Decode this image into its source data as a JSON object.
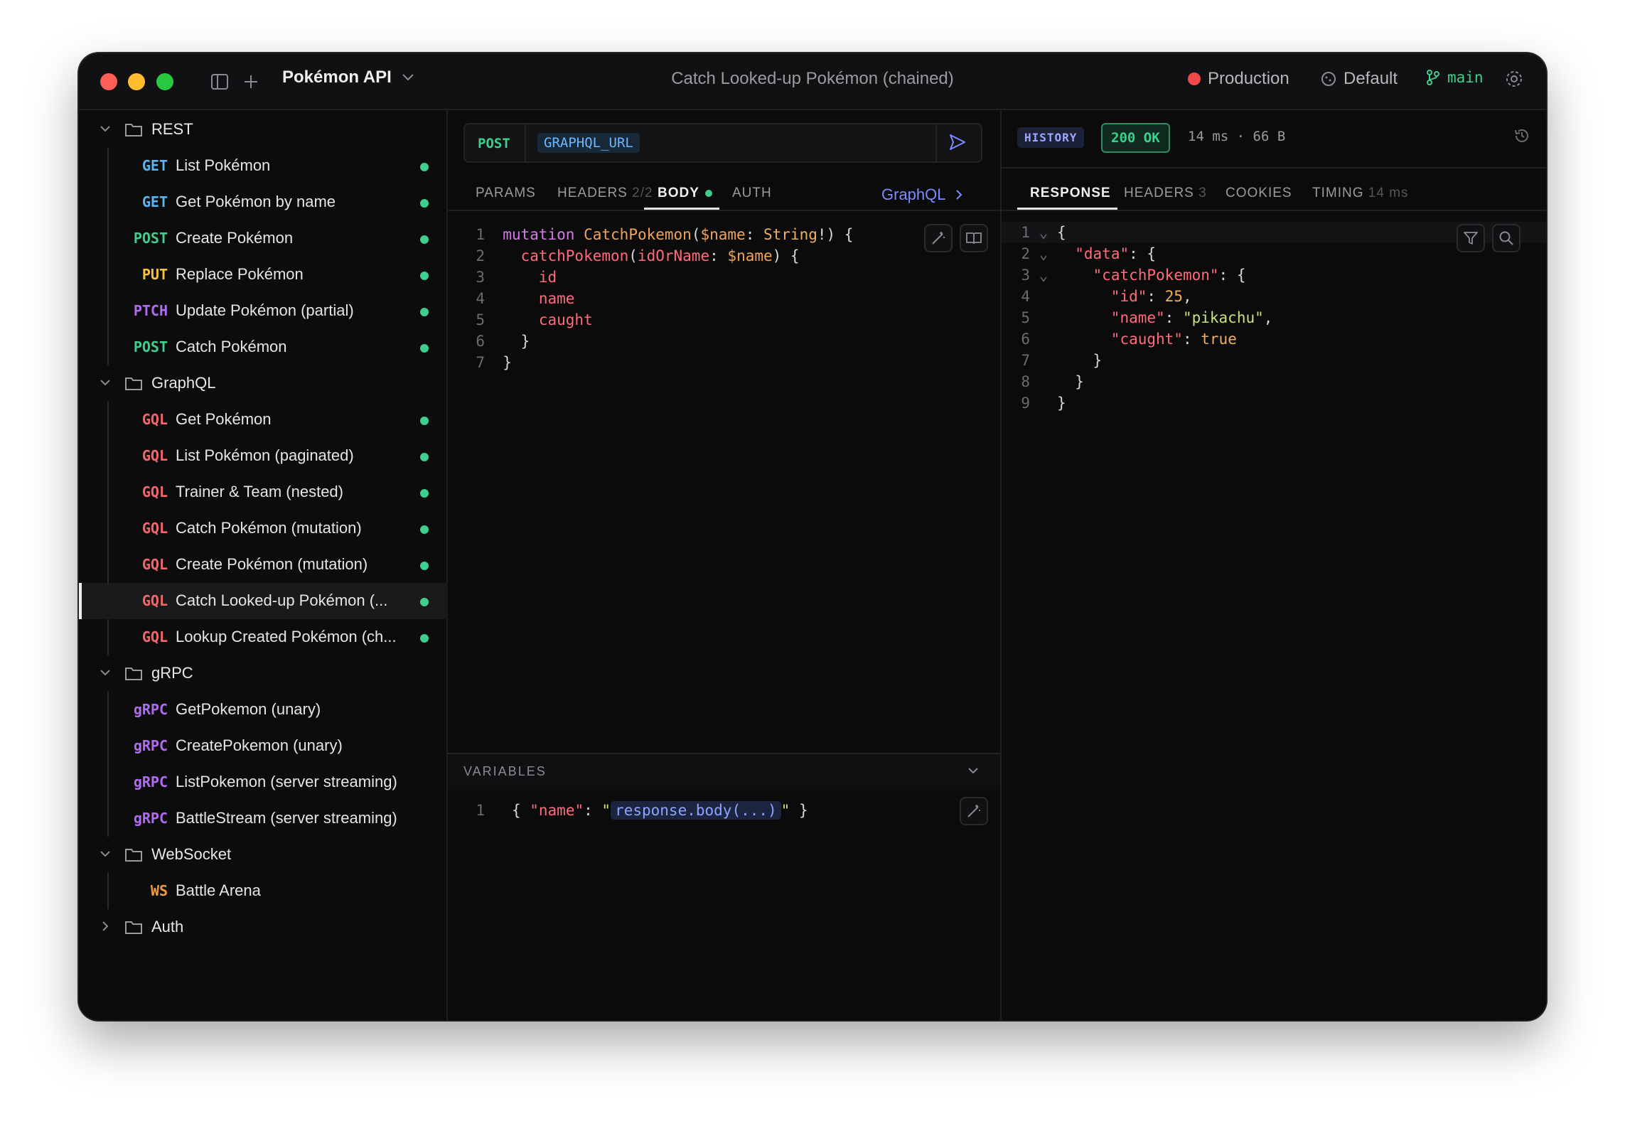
{
  "titlebar": {
    "app_name": "Pokémon API",
    "request_title": "Catch Looked-up Pokémon (chained)",
    "env_production": "Production",
    "env_default": "Default",
    "branch": "main"
  },
  "sidebar": {
    "folders": [
      {
        "name": "REST",
        "expanded": true
      },
      {
        "name": "GraphQL",
        "expanded": true
      },
      {
        "name": "gRPC",
        "expanded": true
      },
      {
        "name": "WebSocket",
        "expanded": true
      },
      {
        "name": "Auth",
        "expanded": false
      }
    ],
    "rest": [
      {
        "method": "GET",
        "label": "List Pokémon",
        "color": "#5ab4f0"
      },
      {
        "method": "GET",
        "label": "Get Pokémon by name",
        "color": "#5ab4f0"
      },
      {
        "method": "POST",
        "label": "Create Pokémon",
        "color": "#3ecf8e"
      },
      {
        "method": "PUT",
        "label": "Replace Pokémon",
        "color": "#f5c242"
      },
      {
        "method": "PTCH",
        "label": "Update Pokémon (partial)",
        "color": "#b06cf0"
      },
      {
        "method": "POST",
        "label": "Catch Pokémon",
        "color": "#3ecf8e"
      }
    ],
    "graphql": [
      {
        "method": "GQL",
        "label": "Get Pokémon",
        "color": "#f0686b"
      },
      {
        "method": "GQL",
        "label": "List Pokémon (paginated)",
        "color": "#f0686b"
      },
      {
        "method": "GQL",
        "label": "Trainer & Team (nested)",
        "color": "#f0686b"
      },
      {
        "method": "GQL",
        "label": "Catch Pokémon (mutation)",
        "color": "#f0686b"
      },
      {
        "method": "GQL",
        "label": "Create Pokémon (mutation)",
        "color": "#f0686b"
      },
      {
        "method": "GQL",
        "label": "Catch Looked-up Pokémon (...",
        "color": "#f0686b",
        "selected": true
      },
      {
        "method": "GQL",
        "label": "Lookup Created Pokémon (ch...",
        "color": "#f0686b"
      }
    ],
    "grpc": [
      {
        "method": "gRPC",
        "label": "GetPokemon (unary)",
        "color": "#b06cf0"
      },
      {
        "method": "gRPC",
        "label": "CreatePokemon (unary)",
        "color": "#b06cf0"
      },
      {
        "method": "gRPC",
        "label": "ListPokemon (server streaming)",
        "color": "#b06cf0"
      },
      {
        "method": "gRPC",
        "label": "BattleStream (server streaming)",
        "color": "#b06cf0"
      }
    ],
    "websocket": [
      {
        "method": "WS",
        "label": "Battle Arena",
        "color": "#f59a3c"
      }
    ]
  },
  "request": {
    "method": "POST",
    "url_var": "GRAPHQL_URL",
    "tabs": {
      "params": "PARAMS",
      "headers": "HEADERS",
      "headers_count": "2/2",
      "body": "BODY",
      "auth": "AUTH"
    },
    "body_type": "GraphQL",
    "variables_title": "VARIABLES"
  },
  "response": {
    "history_label": "HISTORY",
    "status": "200 OK",
    "meta": "14 ms · 66 B",
    "tabs": {
      "response": "RESPONSE",
      "headers": "HEADERS",
      "headers_count": "3",
      "cookies": "COOKIES",
      "timing": "TIMING",
      "timing_value": "14 ms"
    }
  },
  "colors": {
    "accent": "#7b8cff",
    "success": "#3ecf8e",
    "danger": "#f04a4a"
  }
}
